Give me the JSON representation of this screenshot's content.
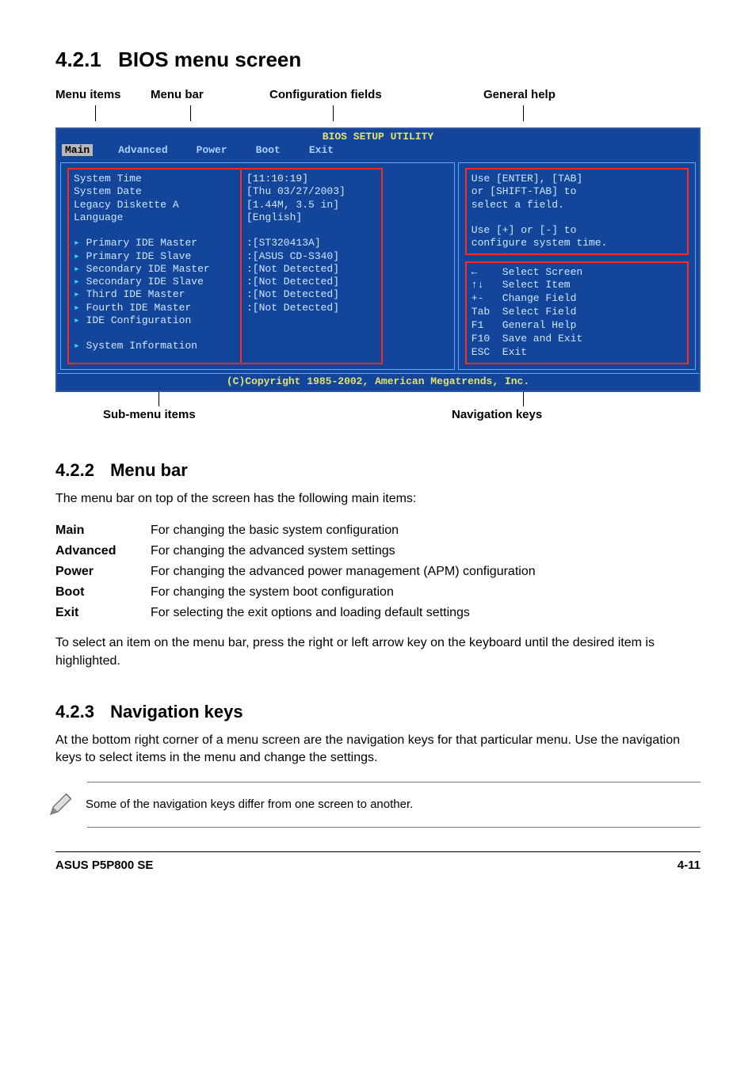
{
  "sections": {
    "s1": {
      "num": "4.2.1",
      "title": "BIOS menu screen"
    },
    "s2": {
      "num": "4.2.2",
      "title": "Menu bar"
    },
    "s3": {
      "num": "4.2.3",
      "title": "Navigation keys"
    }
  },
  "callouts": {
    "menu_items": "Menu items",
    "menu_bar": "Menu bar",
    "config_fields": "Configuration fields",
    "general_help": "General help",
    "submenu": "Sub-menu items",
    "navkeys": "Navigation keys"
  },
  "bios": {
    "title": "BIOS SETUP UTILITY",
    "tabs": [
      "Main",
      "Advanced",
      "Power",
      "Boot",
      "Exit"
    ],
    "active_tab": "Main",
    "left_items": [
      "System Time",
      "System Date",
      "Legacy Diskette A",
      "Language"
    ],
    "left_sub": [
      "Primary IDE Master",
      "Primary IDE Slave",
      "Secondary IDE Master",
      "Secondary IDE Slave",
      "Third IDE Master",
      "Fourth IDE Master",
      "IDE Configuration",
      "",
      "System Information"
    ],
    "values": [
      "[11:10:19]",
      "[Thu 03/27/2003]",
      "[1.44M, 3.5 in]",
      "[English]"
    ],
    "values_sub": [
      ":[ST320413A]",
      ":[ASUS CD-S340]",
      ":[Not Detected]",
      ":[Not Detected]",
      ":[Not Detected]",
      ":[Not Detected]"
    ],
    "help": [
      "Use [ENTER], [TAB]",
      "or [SHIFT-TAB] to",
      "select a field.",
      "",
      "Use [+] or [-] to",
      "configure system time."
    ],
    "nav": [
      "←    Select Screen",
      "↑↓   Select Item",
      "+-   Change Field",
      "Tab  Select Field",
      "F1   General Help",
      "F10  Save and Exit",
      "ESC  Exit"
    ],
    "footer": "(C)Copyright 1985-2002, American Megatrends, Inc."
  },
  "text": {
    "s2_intro": "The menu bar on top of the screen has the following main items:",
    "menu_desc": [
      {
        "key": "Main",
        "desc": "For changing the basic system configuration"
      },
      {
        "key": "Advanced",
        "desc": "For changing the advanced system settings"
      },
      {
        "key": "Power",
        "desc": "For changing the advanced power management (APM) configuration"
      },
      {
        "key": "Boot",
        "desc": "For changing the system boot configuration"
      },
      {
        "key": "Exit",
        "desc": "For selecting the exit options and loading default settings"
      }
    ],
    "s2_p2": "To select an item on the menu bar, press the right or left arrow key on the keyboard until the desired item is highlighted.",
    "s3_p1": "At the bottom right corner of a menu screen are the navigation keys for that particular menu. Use the navigation keys to select items in the menu and change the settings.",
    "note": "Some of the navigation keys differ from one screen to another."
  },
  "footer": {
    "left": "ASUS P5P800 SE",
    "right": "4-11"
  }
}
